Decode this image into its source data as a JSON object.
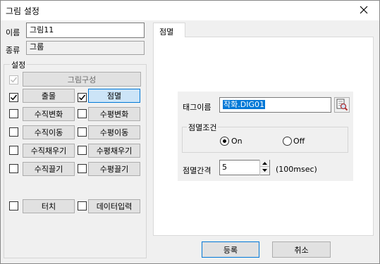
{
  "window": {
    "title": "그림 설정"
  },
  "name_field": {
    "label": "이름",
    "value": "그림11"
  },
  "kind_field": {
    "label": "종류",
    "value": "그룹"
  },
  "settings_group": {
    "title": "설정",
    "items": [
      {
        "label": "그림구성",
        "checked": true,
        "disabled": true
      },
      {
        "label": "출몰",
        "checked": true
      },
      {
        "label": "점멸",
        "checked": true,
        "selected": true
      },
      {
        "label": "수직변화",
        "checked": false
      },
      {
        "label": "수평변화",
        "checked": false
      },
      {
        "label": "수직이동",
        "checked": false
      },
      {
        "label": "수평이동",
        "checked": false
      },
      {
        "label": "수직채우기",
        "checked": false
      },
      {
        "label": "수평채우기",
        "checked": false
      },
      {
        "label": "수직끌기",
        "checked": false
      },
      {
        "label": "수평끌기",
        "checked": false
      },
      {
        "label": "터치",
        "checked": false
      },
      {
        "label": "데이터입력",
        "checked": false
      }
    ]
  },
  "tab": {
    "label": "점멸"
  },
  "blink_panel": {
    "tag_label": "태그이름",
    "tag_value": "작화.DIG01",
    "condition_title": "점멸조건",
    "option_on": "On",
    "option_off": "Off",
    "selected_option": "On",
    "interval_label": "점멸간격",
    "interval_value": "5",
    "interval_unit": "(100msec)"
  },
  "footer": {
    "ok_label": "등록",
    "cancel_label": "취소"
  }
}
